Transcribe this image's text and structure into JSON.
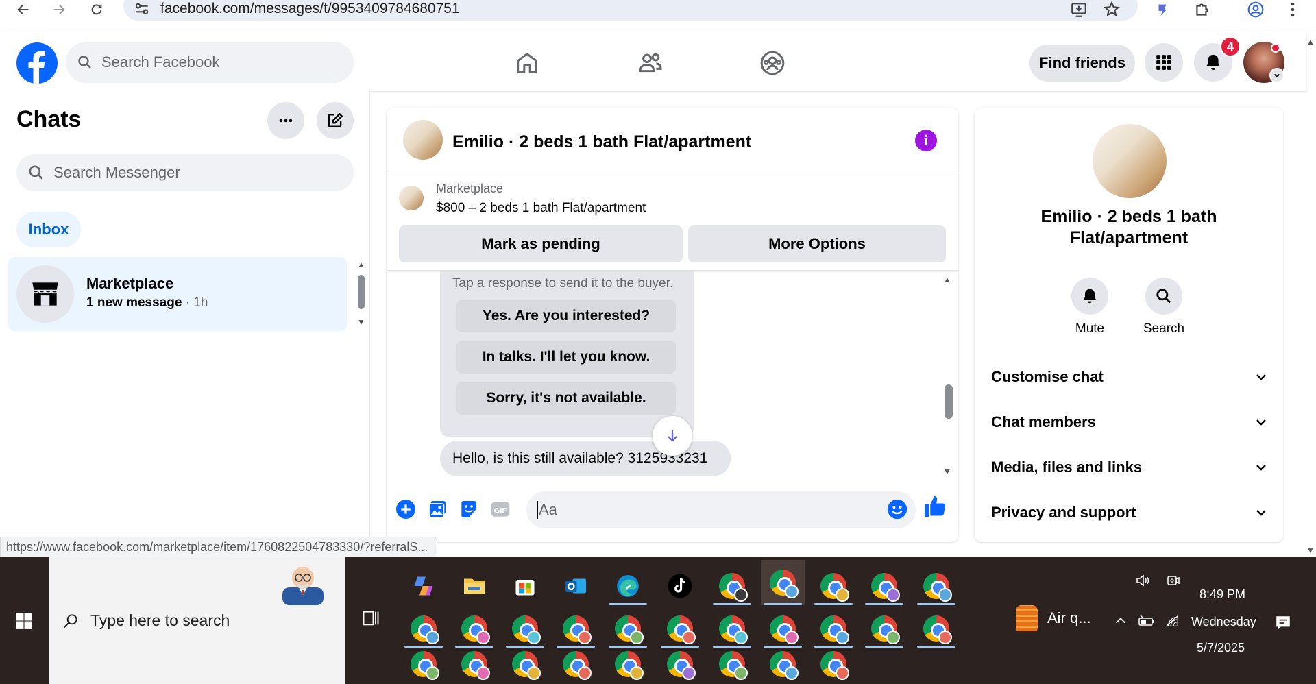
{
  "browser": {
    "url": "facebook.com/messages/t/9953409784680751"
  },
  "header": {
    "search_placeholder": "Search Facebook",
    "find_friends_label": "Find friends",
    "notification_count": "4"
  },
  "left": {
    "title": "Chats",
    "search_placeholder": "Search Messenger",
    "inbox_label": "Inbox",
    "chat": {
      "name": "Marketplace",
      "preview": "1 new message",
      "time": " · 1h"
    }
  },
  "conversation": {
    "title": "Emilio · 2 beds 1 bath Flat/apartment",
    "marketplace_label": "Marketplace",
    "listing": "$800 – 2 beds 1 bath Flat/apartment",
    "mark_pending_label": "Mark as pending",
    "more_options_label": "More Options",
    "hint": "Tap a response to send it to the buyer.",
    "responses": [
      "Yes. Are you interested?",
      "In talks. I'll let you know.",
      "Sorry, it's not available."
    ],
    "message": "Hello, is this still available? 3125933231",
    "composer_placeholder": "Aa"
  },
  "details": {
    "name": "Emilio · 2 beds 1 bath Flat/apartment",
    "mute_label": "Mute",
    "search_label": "Search",
    "sections": [
      "Customise chat",
      "Chat members",
      "Media, files and links",
      "Privacy and support"
    ]
  },
  "status_link": "https://www.facebook.com/marketplace/item/1760822504783330/?referralS...",
  "taskbar": {
    "search_placeholder": "Type here to search",
    "widget_label": "Air q...",
    "time": "8:49 PM",
    "day": "Wednesday",
    "date": "5/7/2025"
  },
  "colors": {
    "facebook_blue": "#0866ff",
    "notification_red": "#e41e3f",
    "info_purple": "#9e14e0",
    "taskbar_bg": "#2c2220"
  }
}
